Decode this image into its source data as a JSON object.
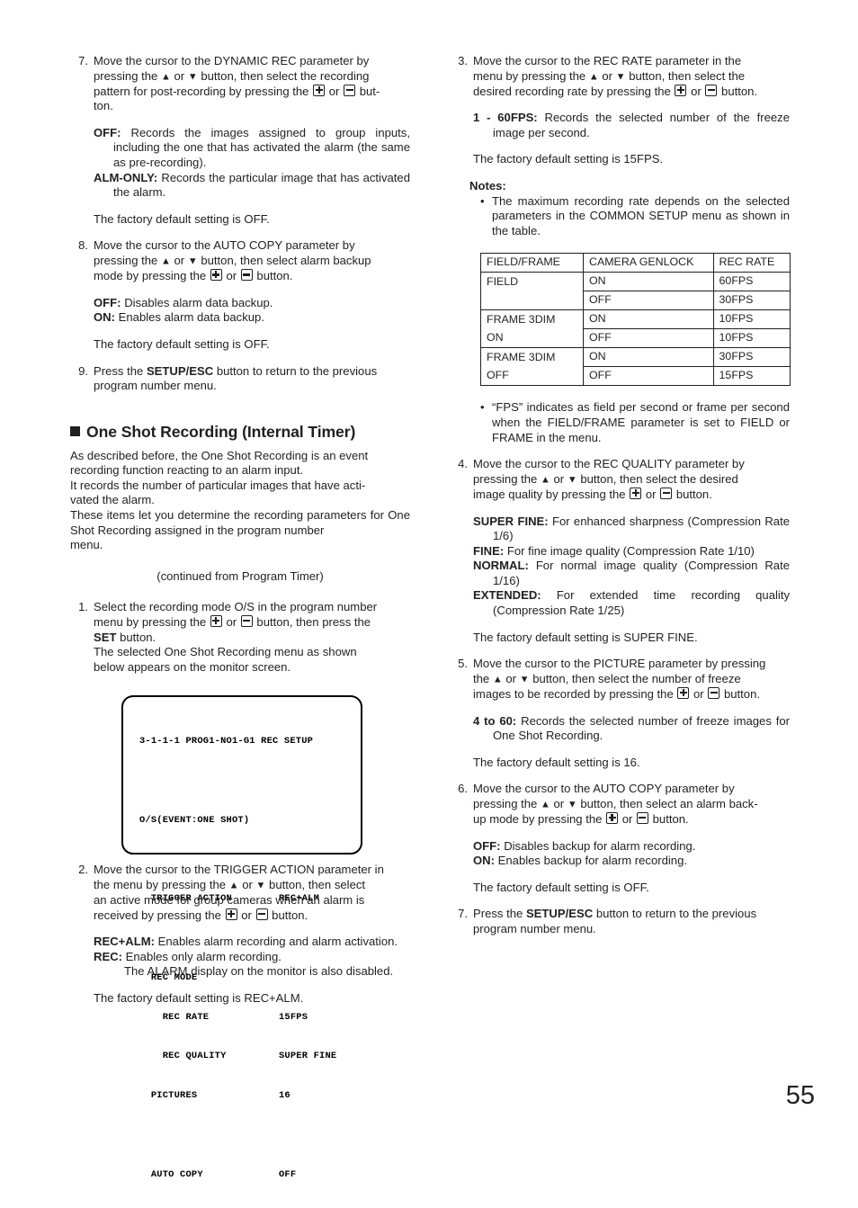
{
  "page_number": "55",
  "left_column": {
    "step7": {
      "num": "7.",
      "line1": "Move the cursor to the DYNAMIC REC parameter by",
      "line2_a": "pressing the",
      "line2_b": "or",
      "line2_c": "button, then select the recording",
      "line3_a": "pattern for post-recording by pressing the",
      "line3_b": "or",
      "line3_c": "but-",
      "line4": "ton.",
      "def_off_label": "OFF:",
      "def_off_text": "Records the images assigned to group inputs, including the one that has activated the alarm (the same as pre-recording).",
      "def_alm_label": "ALM-ONLY:",
      "def_alm_text": "Records the particular image that has activated the alarm.",
      "default_text": "The factory default setting is OFF."
    },
    "step8": {
      "num": "8.",
      "line1": "Move the cursor to the AUTO COPY parameter by",
      "line2_a": "pressing the",
      "line2_b": "or",
      "line2_c": "button, then select alarm backup",
      "line3_a": "mode by pressing the",
      "line3_b": "or",
      "line3_c": "button.",
      "def_off_label": "OFF:",
      "def_off_text": "Disables alarm data backup.",
      "def_on_label": "ON:",
      "def_on_text": "Enables alarm data backup.",
      "default_text": "The factory default setting is OFF."
    },
    "step9": {
      "num": "9.",
      "text_a": "Press the",
      "text_bold": "SETUP/ESC",
      "text_b": "button to return to the previous",
      "text_c": "program number menu."
    },
    "heading": "One Shot Recording (Internal Timer)",
    "intro": {
      "line1": "As described before, the One Shot Recording is an event",
      "line2": "recording function reacting to an alarm input.",
      "line3": "It records the number of particular images that have acti-",
      "line4": "vated the alarm.",
      "line5": "These items let you determine the recording parameters for",
      "line6": "One Shot Recording assigned in the program number",
      "line7": "menu."
    },
    "continued_note": "(continued from Program Timer)",
    "step1": {
      "num": "1.",
      "line1": "Select the recording mode O/S in the program number",
      "line2_a": "menu by pressing the",
      "line2_b": "or",
      "line2_c": "button, then press the",
      "line3_bold": "SET",
      "line3_rest": "button.",
      "line4": "The selected One Shot Recording menu as shown",
      "line5": "below appears on the monitor screen."
    },
    "monitor": {
      "title": "3-1-1-1 PROG1-NO1-G1 REC SETUP",
      "subtitle": "O/S(EVENT:ONE SHOT)",
      "rows": [
        {
          "label": "TRIGGER ACTION",
          "value": "REC+ALM",
          "indent": 1
        },
        {
          "label": "",
          "value": "",
          "indent": 0
        },
        {
          "label": "REC MODE",
          "value": "",
          "indent": 1
        },
        {
          "label": "REC RATE",
          "value": "15FPS",
          "indent": 2
        },
        {
          "label": "REC QUALITY",
          "value": "SUPER FINE",
          "indent": 2
        },
        {
          "label": "PICTURES",
          "value": "16",
          "indent": 1
        },
        {
          "label": "",
          "value": "",
          "indent": 0
        },
        {
          "label": "AUTO COPY",
          "value": "OFF",
          "indent": 1
        }
      ]
    },
    "step2": {
      "num": "2.",
      "line1": "Move the cursor to the TRIGGER ACTION parameter in",
      "line2_a": "the menu by pressing the",
      "line2_b": "or",
      "line2_c": "button, then select",
      "line3": "an active mode for group cameras when an alarm is",
      "line4_a": "received by pressing the",
      "line4_b": "or",
      "line4_c": "button.",
      "def_recalm_label": "REC+ALM:",
      "def_recalm_text": "Enables alarm recording and alarm activation.",
      "def_rec_label": "REC:",
      "def_rec_text": "Enables only alarm recording.",
      "def_rec_sub": "The ALARM display on the monitor is also disabled.",
      "default_text": "The factory default setting is REC+ALM."
    }
  },
  "right_column": {
    "step3": {
      "num": "3.",
      "line1": "Move the cursor to the REC RATE parameter in the",
      "line2_a": "menu by pressing the",
      "line2_b": "or",
      "line2_c": "button, then select the",
      "line3_a": "desired recording rate by pressing the",
      "line3_b": "or",
      "line3_c": "button.",
      "def_fps_label": "1 - 60FPS:",
      "def_fps_text": "Records the selected number of the freeze image per second.",
      "default_text": "The factory default setting is 15FPS."
    },
    "notes": {
      "title": "Notes:",
      "bullet1": "The maximum recording rate depends on the selected parameters in the COMMON SETUP menu as shown in the table.",
      "bullet2": "“FPS” indicates as field per second or frame per second when the FIELD/FRAME parameter is set to FIELD or FRAME in the menu."
    },
    "table": {
      "headers": [
        "FIELD/FRAME",
        "CAMERA GENLOCK",
        "REC RATE"
      ],
      "rows": [
        {
          "field_frame": "FIELD",
          "genlock": "ON",
          "rec_rate": "60FPS"
        },
        {
          "field_frame": "",
          "genlock": "OFF",
          "rec_rate": "30FPS"
        },
        {
          "field_frame": "FRAME 3DIM",
          "genlock": "ON",
          "rec_rate": "10FPS"
        },
        {
          "field_frame": "ON",
          "genlock": "OFF",
          "rec_rate": "10FPS"
        },
        {
          "field_frame": "FRAME 3DIM",
          "genlock": "ON",
          "rec_rate": "30FPS"
        },
        {
          "field_frame": "OFF",
          "genlock": "OFF",
          "rec_rate": "15FPS"
        }
      ]
    },
    "step4": {
      "num": "4.",
      "line1": "Move the cursor to the REC QUALITY parameter by",
      "line2_a": "pressing the",
      "line2_b": "or",
      "line2_c": "button, then select the desired",
      "line3_a": "image quality by pressing the",
      "line3_b": "or",
      "line3_c": "button.",
      "def_superfine_label": "SUPER FINE:",
      "def_superfine_text": "For enhanced sharpness (Compression Rate 1/6)",
      "def_fine_label": "FINE:",
      "def_fine_text": "For fine image quality (Compression Rate 1/10)",
      "def_normal_label": "NORMAL:",
      "def_normal_text": "For normal image quality (Compression Rate 1/16)",
      "def_extended_label": "EXTENDED:",
      "def_extended_text": "For extended time recording quality (Compression Rate 1/25)",
      "default_text": "The factory default setting is SUPER FINE."
    },
    "step5": {
      "num": "5.",
      "line1": "Move the cursor to the PICTURE parameter by pressing",
      "line2_a": "the",
      "line2_b": "or",
      "line2_c": "button, then select the number of freeze",
      "line3_a": "images to be recorded by pressing the",
      "line3_b": "or",
      "line3_c": "button.",
      "def_label": "4 to 60:",
      "def_text": "Records the selected number of freeze images for One Shot Recording.",
      "default_text": "The factory default setting is 16."
    },
    "step6": {
      "num": "6.",
      "line1": "Move the cursor to the AUTO COPY parameter by",
      "line2_a": "pressing the",
      "line2_b": "or",
      "line2_c": "button, then select an alarm back-",
      "line3_a": "up mode by pressing the",
      "line3_b": "or",
      "line3_c": "button.",
      "def_off_label": "OFF:",
      "def_off_text": "Disables backup for alarm recording.",
      "def_on_label": "ON:",
      "def_on_text": "Enables backup for alarm recording.",
      "default_text": "The factory default setting is OFF."
    },
    "step7": {
      "num": "7.",
      "text_a": "Press the",
      "text_bold": "SETUP/ESC",
      "text_b": "button to return to the previous",
      "text_c": "program number menu."
    }
  },
  "icons": {
    "up_triangle": "▲",
    "down_triangle": "▼",
    "plus_key": "plus-key-icon",
    "minus_key": "minus-key-icon",
    "heading_square": "■"
  }
}
